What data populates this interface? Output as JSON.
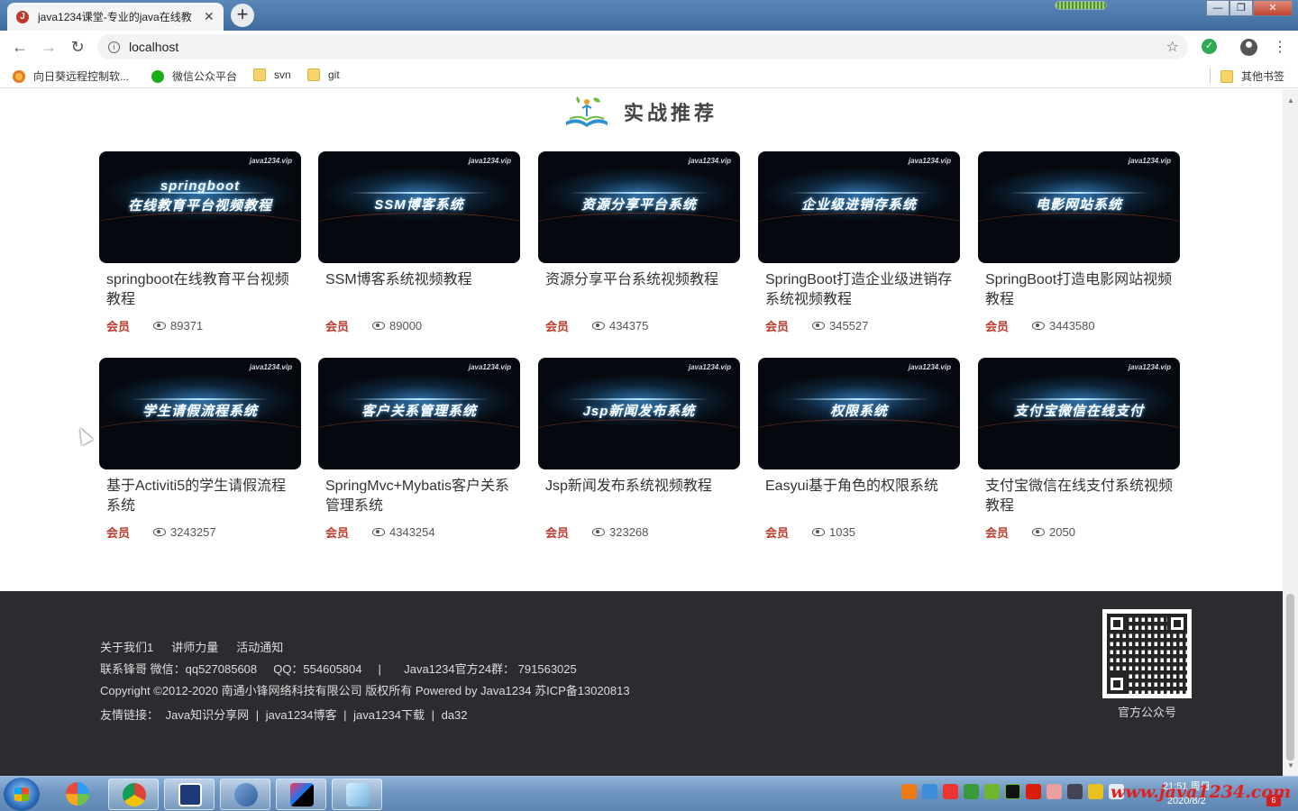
{
  "browser": {
    "tab_title": "java1234课堂-专业的java在线教",
    "url": "localhost",
    "bookmarks": [
      {
        "label": "向日葵远程控制软...",
        "icon": "sunflower-icon"
      },
      {
        "label": "微信公众平台",
        "icon": "wechat-icon"
      },
      {
        "label": "svn",
        "icon": "folder-icon"
      },
      {
        "label": "git",
        "icon": "folder-icon"
      }
    ],
    "other_bookmarks": "其他书签"
  },
  "section": {
    "title": "实战推荐"
  },
  "courses": [
    {
      "banner": "springboot",
      "banner2": "在线教育平台视频教程",
      "name": "springboot在线教育平台视频教程",
      "badge": "会员",
      "views": "89371"
    },
    {
      "banner": "SSM博客系统",
      "banner2": "",
      "name": "SSM博客系统视频教程",
      "badge": "会员",
      "views": "89000"
    },
    {
      "banner": "资源分享平台系统",
      "banner2": "",
      "name": "资源分享平台系统视频教程",
      "badge": "会员",
      "views": "434375"
    },
    {
      "banner": "企业级进销存系统",
      "banner2": "",
      "name": "SpringBoot打造企业级进销存系统视频教程",
      "badge": "会员",
      "views": "345527"
    },
    {
      "banner": "电影网站系统",
      "banner2": "",
      "name": "SpringBoot打造电影网站视频教程",
      "badge": "会员",
      "views": "3443580"
    },
    {
      "banner": "学生请假流程系统",
      "banner2": "",
      "name": "基于Activiti5的学生请假流程系统",
      "badge": "会员",
      "views": "3243257"
    },
    {
      "banner": "客户关系管理系统",
      "banner2": "",
      "name": "SpringMvc+Mybatis客户关系管理系统",
      "badge": "会员",
      "views": "4343254"
    },
    {
      "banner": "Jsp新闻发布系统",
      "banner2": "",
      "name": "Jsp新闻发布系统视频教程",
      "badge": "会员",
      "views": "323268"
    },
    {
      "banner": "权限系统",
      "banner2": "",
      "name": "Easyui基于角色的权限系统",
      "badge": "会员",
      "views": "1035"
    },
    {
      "banner": "支付宝微信在线支付",
      "banner2": "",
      "name": "支付宝微信在线支付系统视频教程",
      "badge": "会员",
      "views": "2050"
    }
  ],
  "thumb_watermark": "java1234.vip",
  "footer": {
    "links": [
      "关于我们1",
      "讲师力量",
      "活动通知"
    ],
    "contact": "联系锋哥 微信：qq527085608     QQ：554605804     |       Java1234官方24群： 791563025",
    "copyright": "Copyright ©2012-2020 南通小锋网络科技有限公司 版权所有 Powered by Java1234 苏ICP备13020813",
    "friends_label": "友情链接：",
    "friends": [
      "Java知识分享网",
      "java1234博客",
      "java1234下载",
      "da32"
    ],
    "qr_label": "官方公众号"
  },
  "taskbar": {
    "clock_time": "21:51 周日",
    "clock_date": "2020/8/2",
    "brand": "www.java1234.com",
    "notif_count": "6"
  }
}
